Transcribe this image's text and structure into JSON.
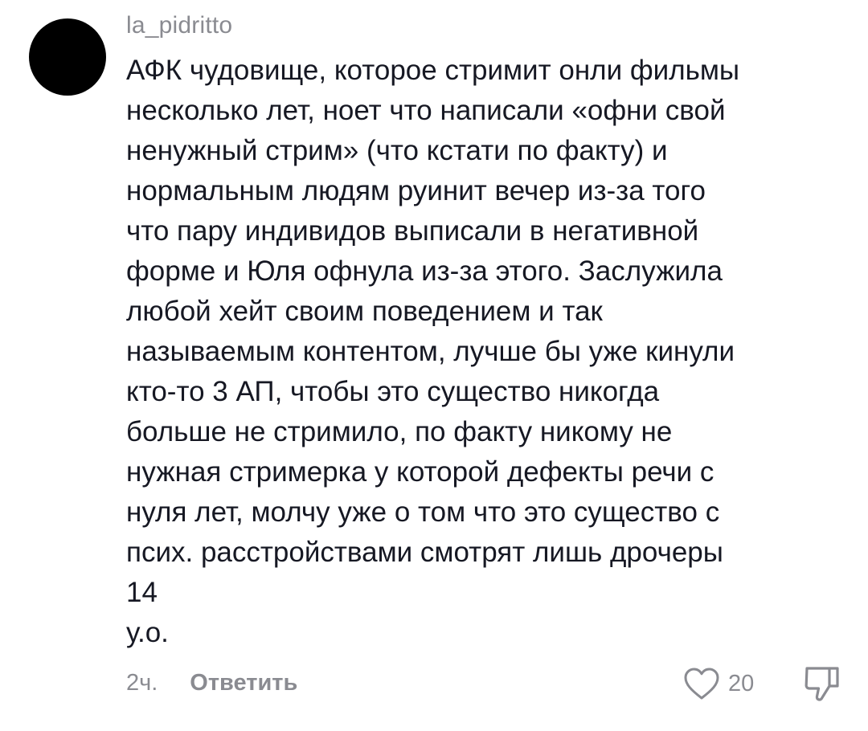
{
  "comment": {
    "username": "la_pidritto",
    "text": "АФК чудовище, которое стримит онли фильмы\nнесколько лет, ноет что написали «офни свой\nненужный стрим» (что кстати по факту) и\nнормальным людям руинит вечер из-за того\nчто пару индивидов выписали в негативной\nформе и Юля офнула из-за этого. Заслужила\nлюбой хейт своим поведением и так\nназываемым контентом, лучше бы уже кинули\nкто-то 3 АП, чтобы это существо никогда\nбольше не стримило, по факту никому не\nнужная стримерка у которой дефекты речи с\nнуля лет, молчу уже о том что это существо с\nпсих. расстройствами смотрят лишь дрочеры\n14\nу.о.",
    "time": "2ч.",
    "reply_label": "Ответить",
    "like_count": "20"
  },
  "icons": {
    "like": "heart-outline-icon",
    "dislike": "thumbs-down-outline-icon"
  },
  "colors": {
    "text": "#161823",
    "secondary": "#8a8b91",
    "avatar": "#000000",
    "background": "#ffffff"
  }
}
